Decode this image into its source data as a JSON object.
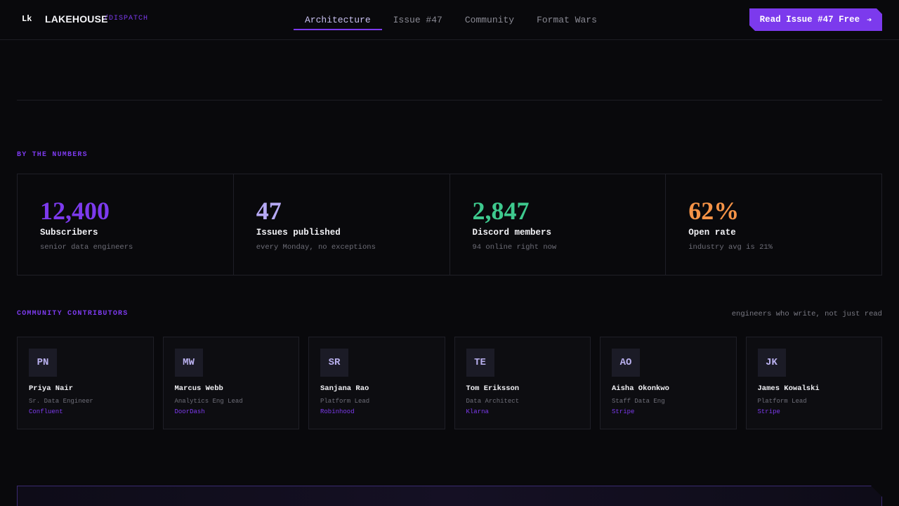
{
  "header": {
    "logo_mark": "Lk",
    "brand": "LAKEHOUSE",
    "brand_sub": "/DISPATCH",
    "nav": [
      {
        "label": "Architecture",
        "active": true
      },
      {
        "label": "Issue #47",
        "active": false
      },
      {
        "label": "Community",
        "active": false
      },
      {
        "label": "Format Wars",
        "active": false
      }
    ],
    "cta_label": "Read Issue #47 Free"
  },
  "numbers": {
    "label": "BY THE NUMBERS",
    "stats": [
      {
        "value": "12,400",
        "label": "Subscribers",
        "sub": "senior data engineers",
        "color": "#7c3aed"
      },
      {
        "value": "47",
        "label": "Issues published",
        "sub": "every Monday, no exceptions",
        "color": "#b6a9f5"
      },
      {
        "value": "2,847",
        "label": "Discord members",
        "sub": "94 online right now",
        "color": "#3ec98e"
      },
      {
        "value": "62%",
        "label": "Open rate",
        "sub": "industry avg is 21%",
        "color": "#f59347"
      }
    ]
  },
  "community": {
    "label": "COMMUNITY CONTRIBUTORS",
    "note": "engineers who write, not just read",
    "contributors": [
      {
        "initials": "PN",
        "name": "Priya Nair",
        "role": "Sr. Data Engineer",
        "company": "Confluent"
      },
      {
        "initials": "MW",
        "name": "Marcus Webb",
        "role": "Analytics Eng Lead",
        "company": "DoorDash"
      },
      {
        "initials": "SR",
        "name": "Sanjana Rao",
        "role": "Platform Lead",
        "company": "Robinhood"
      },
      {
        "initials": "TE",
        "name": "Tom Eriksson",
        "role": "Data Architect",
        "company": "Klarna"
      },
      {
        "initials": "AO",
        "name": "Aisha Okonkwo",
        "role": "Staff Data Eng",
        "company": "Stripe"
      },
      {
        "initials": "JK",
        "name": "James Kowalski",
        "role": "Platform Lead",
        "company": "Stripe"
      }
    ]
  },
  "colors": {
    "accent": "#7c3aed",
    "background": "#09090c"
  }
}
